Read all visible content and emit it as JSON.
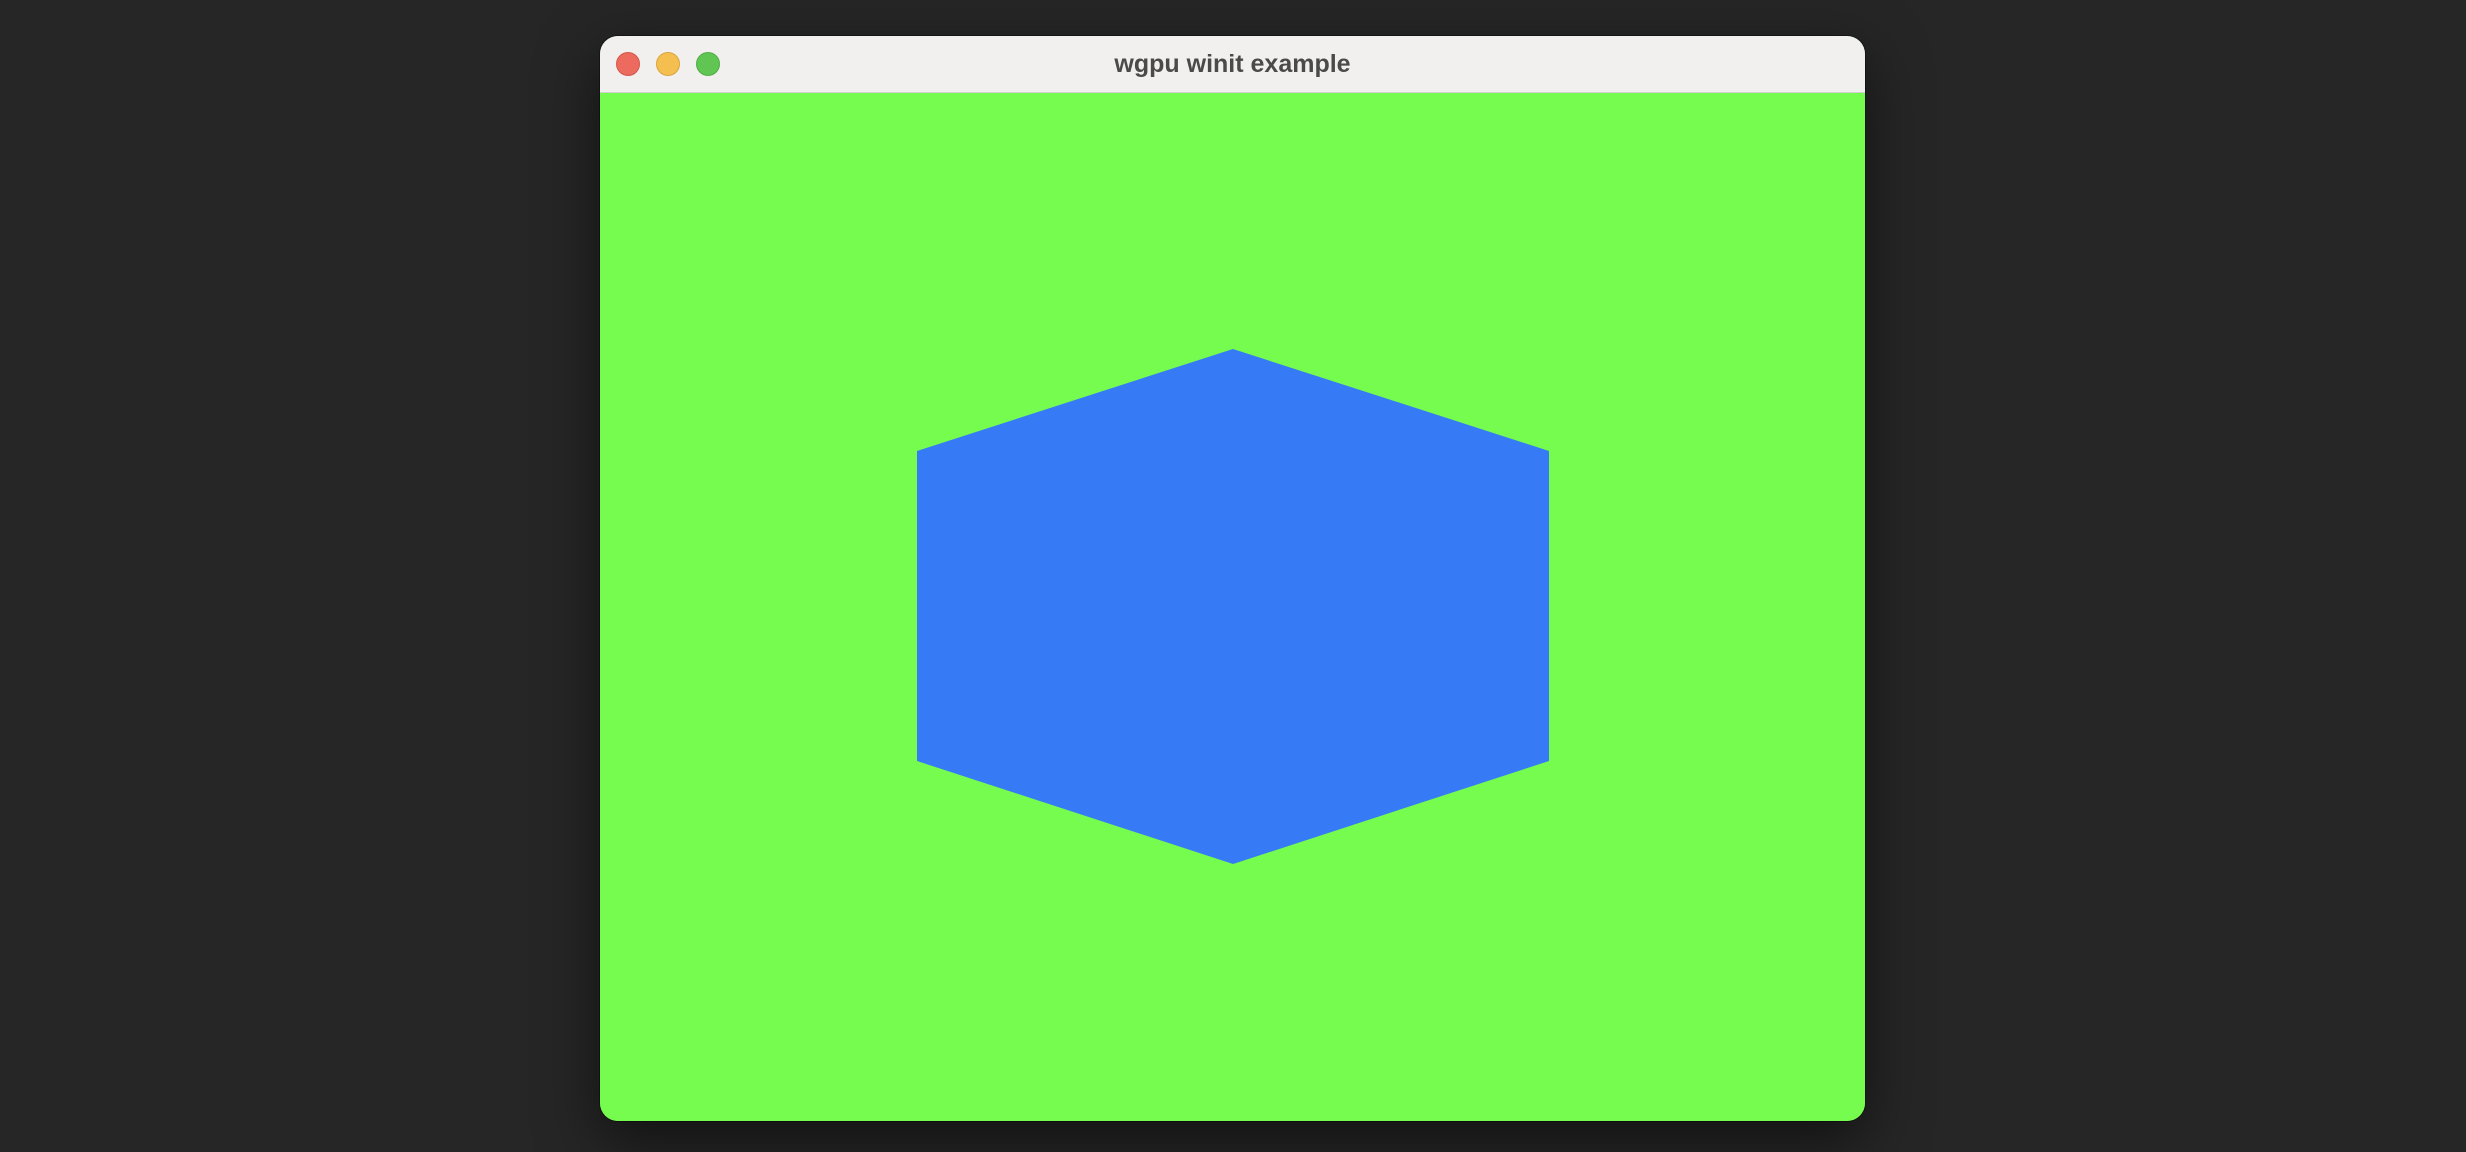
{
  "window": {
    "title": "wgpu winit example"
  },
  "colors": {
    "desktop_background": "#262626",
    "titlebar_background": "#F1F0EE",
    "clear_color": "#76FB4F",
    "hexagon_fill": "#367BF5",
    "close_button": "#EC6A5E",
    "minimize_button": "#F4BF4F",
    "maximize_button": "#61C554"
  },
  "scene": {
    "shape": "hexagon"
  }
}
